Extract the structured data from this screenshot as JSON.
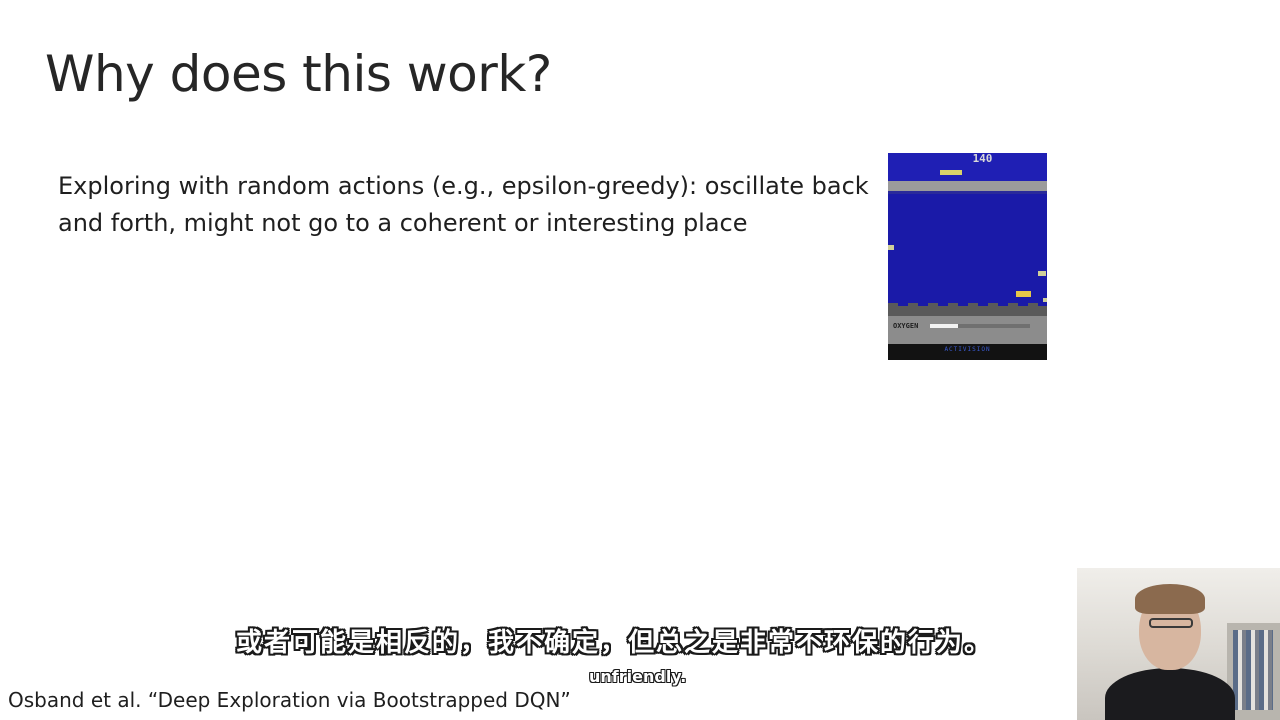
{
  "slide": {
    "title": "Why does this work?",
    "bullet": "Exploring with random actions (e.g., epsilon-greedy): oscillate back and forth, might not go to a coherent or interesting place",
    "citation": "Osband et al. “Deep Exploration via Bootstrapped DQN”"
  },
  "game": {
    "score": "140",
    "oxygen_label": "OXYGEN",
    "oxygen_level": 0.28,
    "footer_text": "ACTIVISION",
    "colors": {
      "water": "#1a1aa8",
      "hud": "#8c8c8c",
      "sub": "#e6c84a"
    }
  },
  "subtitles": {
    "chinese": "或者可能是相反的，我不确定，但总之是非常不环保的行为。",
    "english": "unfriendly."
  }
}
